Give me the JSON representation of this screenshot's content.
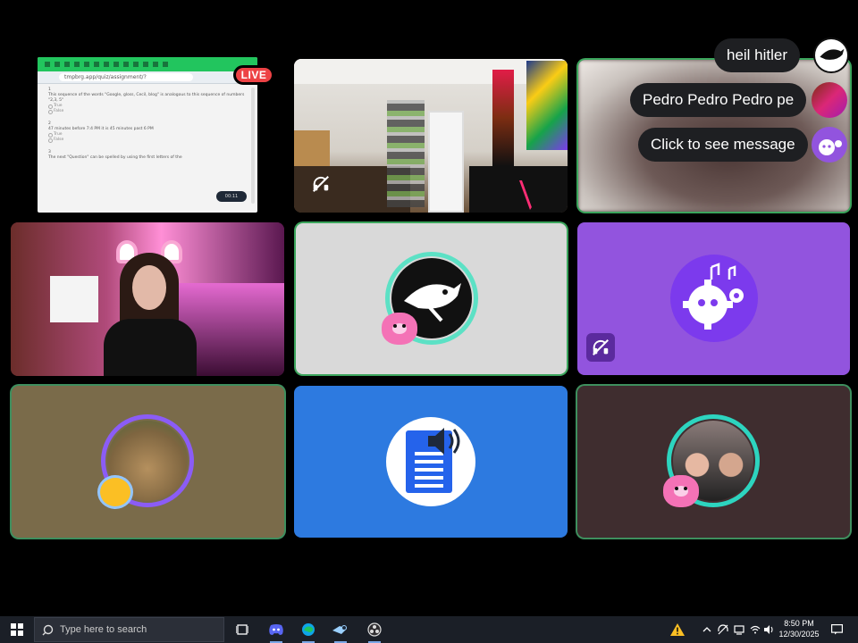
{
  "stream_tile": {
    "live_label": "LIVE",
    "url": "tmpbrg.app/quiz/assignment/?",
    "questions": [
      {
        "number": "1",
        "text": "This sequence of the words \"Google, gloss, Cecil, blog\" is analogous to this sequence of numbers \"2,3, 5\"",
        "options": [
          "True",
          "False"
        ]
      },
      {
        "number": "2",
        "text": "47 minutes before 7:4 PM it is 45 minutes past 6 PM",
        "options": [
          "True",
          "False"
        ]
      },
      {
        "number": "3",
        "text": "The next \"Question\" can be spelled by using the first letters of the"
      }
    ],
    "pill_text": "00:11"
  },
  "chat": [
    {
      "text": "heil hitler",
      "avatar_icon": "shark-avatar-icon"
    },
    {
      "text": "Pedro Pedro Pedro pe",
      "avatar_icon": "anime-avatar-icon"
    },
    {
      "text": "Click to see message",
      "avatar_icon": "gear-bot-avatar-icon"
    }
  ],
  "taskbar": {
    "search_placeholder": "Type here to search",
    "time": "8:50 PM",
    "date": "12/30/2025",
    "apps": [
      "task-view-icon",
      "discord-icon",
      "edge-icon",
      "steam-icon",
      "obs-icon"
    ]
  },
  "colors": {
    "speaking_border": "#3ba55c",
    "live_red": "#ed4245",
    "bot_purple": "#9254de",
    "tts_blue": "#2d7ae0",
    "taskbar": "#1b1f27"
  }
}
